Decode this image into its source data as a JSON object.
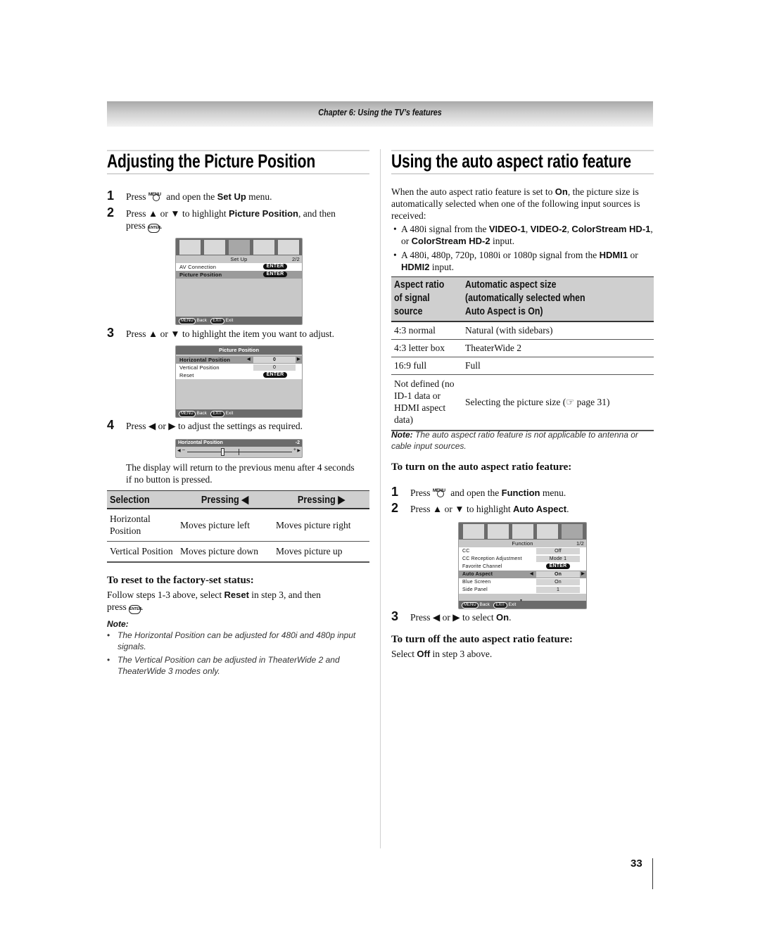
{
  "header": {
    "chapter": "Chapter 6: Using the TV’s features"
  },
  "left": {
    "title": "Adjusting the Picture Position",
    "steps": [
      {
        "num": "1",
        "pre": "Press",
        "icon": "menu-button-icon",
        "icon_label": "MENU",
        "mid": "and open the",
        "bold": "Set Up",
        "post": "menu."
      },
      {
        "num": "2",
        "pre": "Press ▲ or ▼ to highlight",
        "bold": "Picture Position",
        "post": ", and then",
        "line2": "press",
        "icon": "enter-button-icon",
        "icon_label": "ENTER"
      },
      {
        "num": "3",
        "text": "Press ▲ or ▼ to highlight the item you want to adjust."
      },
      {
        "num": "4",
        "text": "Press ◀ or ▶ to adjust the settings as required."
      }
    ],
    "osd_setup": {
      "title": "Set Up",
      "page": "2/2",
      "items": [
        {
          "label": "AV Connection",
          "value": "ENTER"
        },
        {
          "label": "Picture Position",
          "value": "ENTER"
        }
      ],
      "footer_back_key": "MENU",
      "footer_back": "Back",
      "footer_exit_key": "EXIT",
      "footer_exit": "Exit"
    },
    "osd_position": {
      "title": "Picture Position",
      "items": [
        {
          "label": "Horizontal Position",
          "value": "0"
        },
        {
          "label": "Vertical Position",
          "value": "0"
        },
        {
          "label": "Reset",
          "value": "ENTER"
        }
      ],
      "footer_back_key": "MENU",
      "footer_back": "Back",
      "footer_exit_key": "EXIT",
      "footer_exit": "Exit"
    },
    "osd_slider": {
      "label": "Horizontal Position",
      "value": "-2",
      "minus": "–",
      "plus": "+"
    },
    "return_text": "The display will return to the previous menu after 4 seconds if no button is pressed.",
    "table": {
      "headers": [
        "Selection",
        "Pressing ◀",
        "Pressing ▶"
      ],
      "rows": [
        [
          "Horizontal Position",
          "Moves picture left",
          "Moves picture right"
        ],
        [
          "Vertical Position",
          "Moves picture down",
          "Moves picture up"
        ]
      ]
    },
    "reset_heading": "To reset to the factory-set status:",
    "reset_pre": "Follow steps 1-3 above, select",
    "reset_bold": "Reset",
    "reset_post": "in step 3, and then",
    "reset_line2": "press",
    "note_label": "Note:",
    "notes": [
      "The Horizontal Position can be adjusted for 480i and 480p input signals.",
      "The Vertical Position can be adjusted in TheaterWide 2 and TheaterWide 3 modes only."
    ]
  },
  "right": {
    "title": "Using the auto aspect ratio feature",
    "intro_pre": "When the auto aspect ratio feature is set to",
    "intro_bold": "On",
    "intro_post": ", the picture size is automatically selected when one of the following input sources is received:",
    "bullets": [
      {
        "pre": "A 480i signal from the",
        "b1": "VIDEO-1",
        "s1": ",",
        "b2": "VIDEO-2",
        "s2": ",",
        "b3": "ColorStream HD-1",
        "s3": ", or",
        "b4": "ColorStream HD-2",
        "post": "input."
      },
      {
        "pre": "A 480i, 480p, 720p, 1080i or 1080p signal from the",
        "b1": "HDMI1",
        "mid": "or",
        "b2": "HDMI2",
        "post": "input."
      }
    ],
    "table": {
      "headers": [
        "Aspect ratio of signal source",
        "Automatic aspect size (automatically selected when Auto Aspect is On)"
      ],
      "header_lines": [
        [
          "Aspect ratio",
          "of signal",
          "source"
        ],
        [
          "Automatic aspect size",
          "(automatically selected when",
          "Auto Aspect is On)"
        ]
      ],
      "rows": [
        [
          "4:3 normal",
          "Natural (with sidebars)"
        ],
        [
          "4:3 letter box",
          "TheaterWide 2"
        ],
        [
          "16:9 full",
          "Full"
        ],
        [
          "Not defined (no ID-1 data or HDMI aspect data)",
          "Selecting the picture size (☞ page 31)"
        ]
      ]
    },
    "note_label": "Note:",
    "note_text": "The auto aspect ratio feature is not applicable to antenna or cable input sources.",
    "turn_on_heading": "To turn on the auto aspect ratio feature:",
    "steps": [
      {
        "num": "1",
        "pre": "Press",
        "icon_label": "MENU",
        "mid": "and open the",
        "bold": "Function",
        "post": "menu."
      },
      {
        "num": "2",
        "pre": "Press ▲ or ▼ to highlight",
        "bold": "Auto Aspect",
        "post": "."
      },
      {
        "num": "3",
        "pre": "Press ◀ or ▶ to select",
        "bold": "On",
        "post": "."
      }
    ],
    "osd_function": {
      "title": "Function",
      "page": "1/2",
      "items": [
        {
          "label": "CC",
          "value": "Off"
        },
        {
          "label": "CC Reception Adjustment",
          "value": "Mode 1"
        },
        {
          "label": "Favorite Channel",
          "value": "ENTER"
        },
        {
          "label": "Auto Aspect",
          "value": "On"
        },
        {
          "label": "Blue Screen",
          "value": "On"
        },
        {
          "label": "Side Panel",
          "value": "1"
        }
      ],
      "footer_back_key": "MENU",
      "footer_back": "Back",
      "footer_exit_key": "EXIT",
      "footer_exit": "Exit"
    },
    "turn_off_heading": "To turn off the auto aspect ratio feature:",
    "turn_off_pre": "Select",
    "turn_off_bold": "Off",
    "turn_off_post": "in step 3 above."
  },
  "page_number": "33"
}
